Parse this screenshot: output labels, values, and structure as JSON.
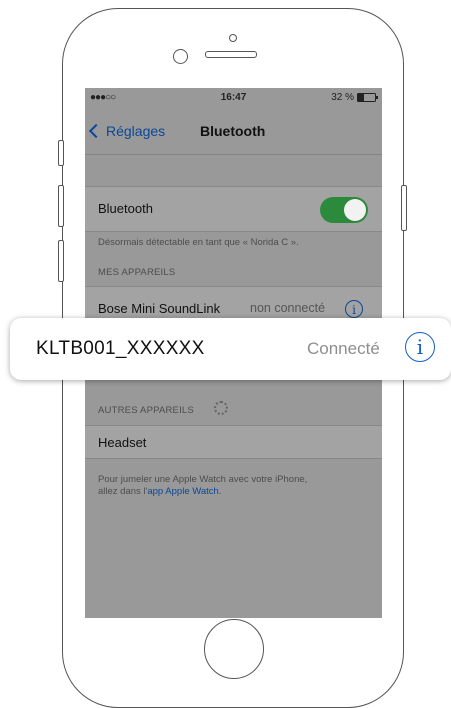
{
  "status_bar": {
    "signal": "●●●○○",
    "time": "16:47",
    "battery": "32 %"
  },
  "nav": {
    "back_label": "Réglages",
    "title": "Bluetooth"
  },
  "bluetooth": {
    "label": "Bluetooth",
    "enabled": true,
    "discoverable_note": "Désormais détectable en tant que « Norida C »."
  },
  "my_devices": {
    "header": "MES APPAREILS",
    "items": [
      {
        "name": "Bose Mini SoundLink",
        "status": "non connecté"
      },
      {
        "name": "KLTB001_XXXXXX",
        "status": "Connecté"
      }
    ]
  },
  "other_devices": {
    "header": "AUTRES APPAREILS",
    "items": [
      {
        "name": "Headset"
      }
    ]
  },
  "watch_note": {
    "line1": "Pour jumeler une Apple Watch avec votre iPhone,",
    "line2_prefix": "allez dans l'",
    "line2_link": "app Apple Watch",
    "line2_suffix": "."
  },
  "colors": {
    "accent": "#0a4797",
    "toggle_on": "#2c8a3c",
    "screen_dim": "#999999"
  },
  "icons": {
    "info": "i"
  }
}
